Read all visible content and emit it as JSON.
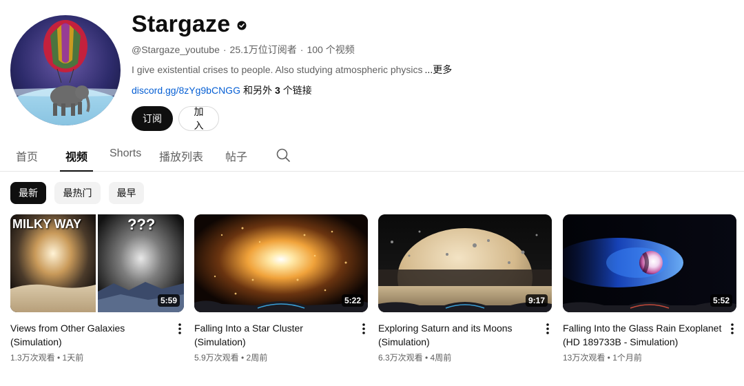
{
  "channel": {
    "name": "Stargaze",
    "handle": "@Stargaze_youtube",
    "subscribers": "25.1万位订阅者",
    "video_count": "100 个视频",
    "description": "I give existential crises to people. Also studying atmospheric physics",
    "more_label": "...更多",
    "link": "discord.gg/8zYg9bCNGG",
    "link_prefix": "和另外",
    "link_count": "3",
    "link_suffix": "个链接",
    "subscribe_label": "订阅",
    "join_label": "加入"
  },
  "tabs": [
    {
      "label": "首页"
    },
    {
      "label": "视频"
    },
    {
      "label": "Shorts"
    },
    {
      "label": "播放列表"
    },
    {
      "label": "帖子"
    }
  ],
  "chips": [
    {
      "label": "最新"
    },
    {
      "label": "最热门"
    },
    {
      "label": "最早"
    }
  ],
  "videos": [
    {
      "title": "Views from Other Galaxies (Simulation)",
      "duration": "5:59",
      "meta": "1.3万次观看 • 1天前",
      "thumb_left_text": "MILKY WAY",
      "thumb_right_text": "???"
    },
    {
      "title": "Falling Into a Star Cluster (Simulation)",
      "duration": "5:22",
      "meta": "5.9万次观看 • 2周前"
    },
    {
      "title": "Exploring Saturn and its Moons (Simulation)",
      "duration": "9:17",
      "meta": "6.3万次观看 • 4周前"
    },
    {
      "title": "Falling Into the Glass Rain Exoplanet (HD 189733B - Simulation)",
      "duration": "5:52",
      "meta": "13万次观看 • 1个月前"
    }
  ],
  "icons": {
    "verified": "verified-check-icon",
    "search": "search-icon",
    "more": "more-vert-icon"
  },
  "colors": {
    "primary_text": "#0f0f0f",
    "secondary_text": "#606060",
    "link": "#065fd4",
    "chip_bg": "#f2f2f2"
  }
}
